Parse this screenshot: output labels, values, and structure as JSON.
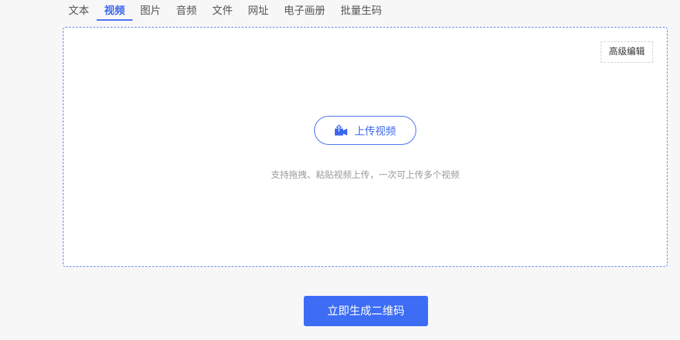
{
  "tabs": [
    {
      "label": "文本"
    },
    {
      "label": "视频",
      "active": true
    },
    {
      "label": "图片"
    },
    {
      "label": "音频"
    },
    {
      "label": "文件"
    },
    {
      "label": "网址"
    },
    {
      "label": "电子画册"
    },
    {
      "label": "批量生码"
    }
  ],
  "upload_area": {
    "advanced_edit_label": "高级编辑",
    "upload_button_label": "上传视频",
    "upload_icon": "video-upload-icon",
    "hint": "支持拖拽、粘贴视频上传，一次可上传多个视频"
  },
  "generate_button_label": "立即生成二维码",
  "colors": {
    "accent": "#3c66f0",
    "primary_button": "#3d6df5",
    "border_dashed": "#5b7fe6",
    "background": "#f7f7f7"
  }
}
